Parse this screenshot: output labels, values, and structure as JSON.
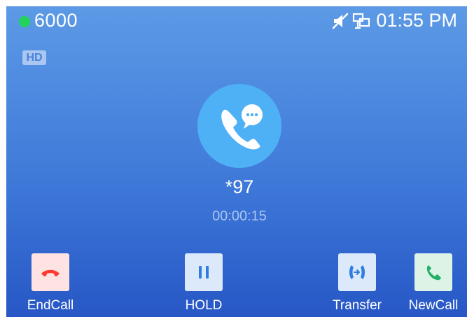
{
  "status_bar": {
    "account": "6000",
    "clock": "01:55 PM",
    "icons": [
      "muted-speaker-icon",
      "network-icon"
    ],
    "account_status_color": "#22d35a"
  },
  "call": {
    "codec_badge": "HD",
    "caller": "*97",
    "duration": "00:00:15",
    "avatar_icon": "phone-chat-icon"
  },
  "softkeys": [
    {
      "label": "EndCall",
      "icon": "hangup-icon",
      "color": "#ff3b30"
    },
    {
      "label": "HOLD",
      "icon": "pause-icon",
      "color": "#2f7de1"
    },
    {
      "label": "Transfer",
      "icon": "transfer-icon",
      "color": "#2f7de1"
    },
    {
      "label": "NewCall",
      "icon": "phone-icon",
      "color": "#23b067"
    }
  ]
}
